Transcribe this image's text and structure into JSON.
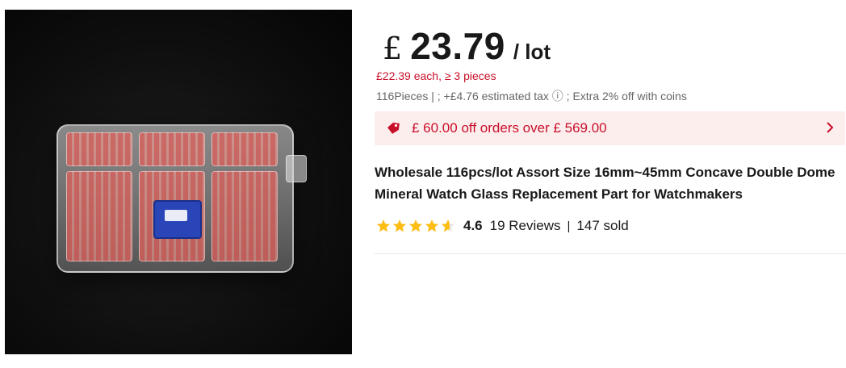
{
  "product": {
    "price": {
      "currency": "£",
      "amount": "23.79",
      "unit": "/ lot"
    },
    "bulk_price": "£22.39 each, ≥ 3 pieces",
    "meta": "116Pieces | ; +£4.76 estimated tax ⓘ ; Extra 2% off with coins",
    "coupon": {
      "text": "£ 60.00 off orders over £ 569.00",
      "tag_icon": "price-tag-icon",
      "chevron_icon": "chevron-right-icon",
      "color": "#c80f2a"
    },
    "title": "Wholesale 116pcs/lot Assort Size 16mm~45mm Concave Double Dome Mineral Watch Glass Replacement Part for Watchmakers",
    "rating": {
      "value": "4.6",
      "stars_filled": 4.6,
      "reviews": "19 Reviews",
      "separator": "|",
      "sold": "147 sold"
    }
  },
  "colors": {
    "accent": "#c80f2a",
    "star": "#fdbd13",
    "banner_bg": "#fdeeee"
  }
}
